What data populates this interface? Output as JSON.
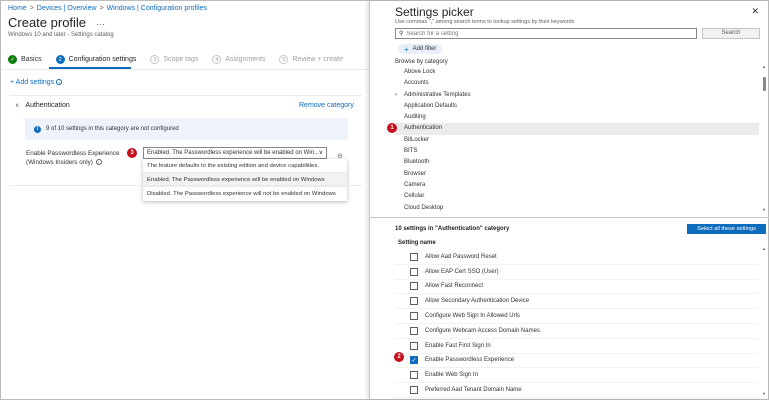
{
  "breadcrumb": [
    "Home",
    "Devices | Overview",
    "Windows | Configuration profiles"
  ],
  "page": {
    "title": "Create profile",
    "ellipsis": "···",
    "subtitle": "Windows 10 and later - Settings catalog"
  },
  "steps": [
    {
      "num": "✓",
      "label": "Basics",
      "state": "done"
    },
    {
      "num": "2",
      "label": "Configuration settings",
      "state": "active"
    },
    {
      "num": "3",
      "label": "Scope tags",
      "state": "pending"
    },
    {
      "num": "4",
      "label": "Assignments",
      "state": "pending"
    },
    {
      "num": "5",
      "label": "Review + create",
      "state": "pending"
    }
  ],
  "add_settings": {
    "label": "+ Add settings",
    "info_glyph": "i"
  },
  "section": {
    "chevron": "∧",
    "title": "Authentication",
    "remove_label": "Remove category",
    "info_glyph": "i",
    "info_text": "9 of 10 settings in this category are not configured"
  },
  "setting": {
    "label_line1": "Enable Passwordless Experience",
    "label_line2": "(Windows Insiders only)",
    "help_glyph": "i",
    "dropdown_value": "Enabled. The Passwordless experience will be enabled on Win...",
    "dropdown_arrow": "∨",
    "clear_glyph": "⊖",
    "options": [
      "The feature defaults to the existing edition and device capabilities.",
      "Enabled. The Passwordless experience will be enabled on Windows",
      "Disabled. The Passwordless experience will not be enabled on Windows"
    ],
    "selected_option_index": 1
  },
  "badges": {
    "one": "1",
    "two": "2",
    "three": "3",
    "color": "#c50f1f"
  },
  "picker": {
    "title": "Settings picker",
    "close_glyph": "✕",
    "hint": "Use commas \",\" among search terms to lookup settings by their keywords",
    "search_glyph": "⚲",
    "search_placeholder": "Search for a setting",
    "search_button": "Search",
    "add_filter_plus": "+",
    "add_filter": "Add filter",
    "browse_heading": "Browse by category",
    "categories": [
      "Above Lock",
      "Accounts",
      "Administrative Templates",
      "Application Defaults",
      "Auditing",
      "Authentication",
      "BitLocker",
      "BITS",
      "Bluetooth",
      "Browser",
      "Camera",
      "Cellular",
      "Cloud Desktop"
    ],
    "expandable_category": "Administrative Templates",
    "expand_glyph": "›",
    "selected_category": "Authentication",
    "scroll_up_glyph": "▲",
    "scroll_down_glyph": "▼",
    "settings_count": "10 settings in \"Authentication\" category",
    "select_all": "Select all these settings",
    "column_header": "Setting name",
    "check_glyph": "✓",
    "settings": [
      {
        "name": "Allow Aad Password Reset",
        "checked": false
      },
      {
        "name": "Allow EAP Cert SSO (User)",
        "checked": false
      },
      {
        "name": "Allow Fast Reconnect",
        "checked": false
      },
      {
        "name": "Allow Secondary Authentication Device",
        "checked": false
      },
      {
        "name": "Configure Web Sign In Allowed Urls",
        "checked": false
      },
      {
        "name": "Configure Webcam Access Domain Names",
        "checked": false
      },
      {
        "name": "Enable Fast First Sign In",
        "checked": false
      },
      {
        "name": "Enable Passwordless Experience",
        "checked": true
      },
      {
        "name": "Enable Web Sign In",
        "checked": false
      },
      {
        "name": "Preferred Aad Tenant Domain Name",
        "checked": false
      }
    ]
  },
  "colors": {
    "accent": "#0f6cbd",
    "success": "#107c10",
    "badge": "#c50f1f"
  }
}
